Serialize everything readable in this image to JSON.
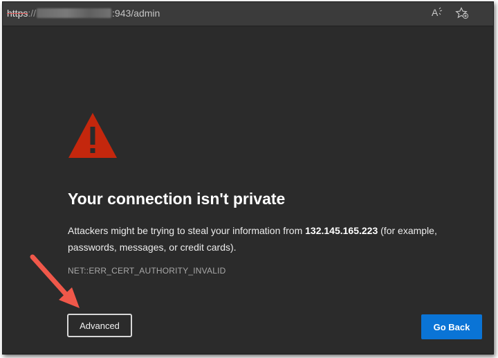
{
  "addressbar": {
    "scheme": "https",
    "separator": "://",
    "url_rest": ":943/admin",
    "icons": [
      "read-aloud-icon",
      "favorite-star-icon"
    ]
  },
  "main": {
    "heading": "Your connection isn't private",
    "message_prefix": "Attackers might be trying to steal your information from ",
    "host": "132.145.165.223",
    "message_suffix": " (for example, passwords, messages, or credit cards).",
    "error_code": "NET::ERR_CERT_AUTHORITY_INVALID"
  },
  "buttons": {
    "advanced_label": "Advanced",
    "go_back_label": "Go Back"
  },
  "colors": {
    "background": "#2b2b2b",
    "warning_red": "#c4270d",
    "primary_blue": "#0a74d6",
    "annotation_arrow": "#f0584a"
  }
}
